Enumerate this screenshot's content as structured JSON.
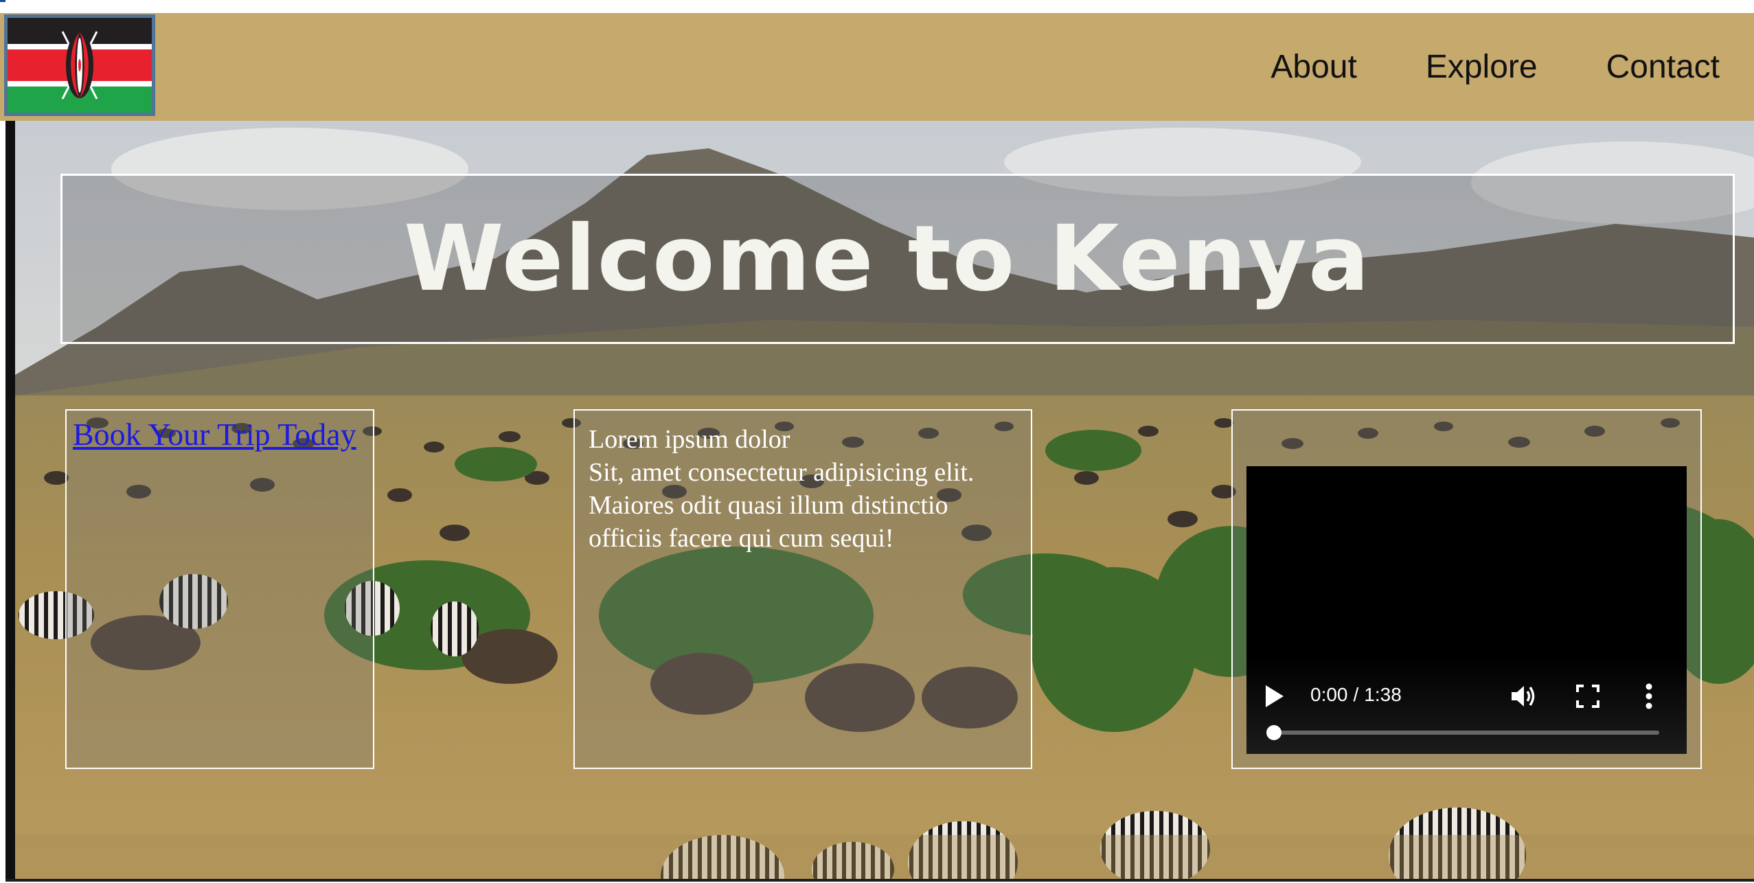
{
  "nav": {
    "logo_alt": "Kenya flag",
    "links": [
      {
        "label": "About"
      },
      {
        "label": "Explore"
      },
      {
        "label": "Contact"
      }
    ]
  },
  "hero": {
    "title": "Welcome to Kenya"
  },
  "book": {
    "link_text": "Book Your Trip Today"
  },
  "text_panel": {
    "lines": [
      "Lorem ipsum dolor",
      "Sit, amet consectetur adipisicing elit.",
      "Maiores odit quasi illum distinctio",
      "officiis facere qui cum sequi!"
    ]
  },
  "video": {
    "current_time": "0:00",
    "separator": "/",
    "duration": "1:38",
    "progress_fraction": 0,
    "play_icon": "play-icon",
    "volume_icon": "volume-icon",
    "fullscreen_icon": "fullscreen-icon",
    "more_icon": "more-options-icon"
  },
  "colors": {
    "navbar_bg": "#c6a96d",
    "link_blue": "#1a1ae0",
    "logo_border": "#4f7596",
    "flag_black": "#231f20",
    "flag_red": "#e8212f",
    "flag_green": "#1fa44a"
  }
}
